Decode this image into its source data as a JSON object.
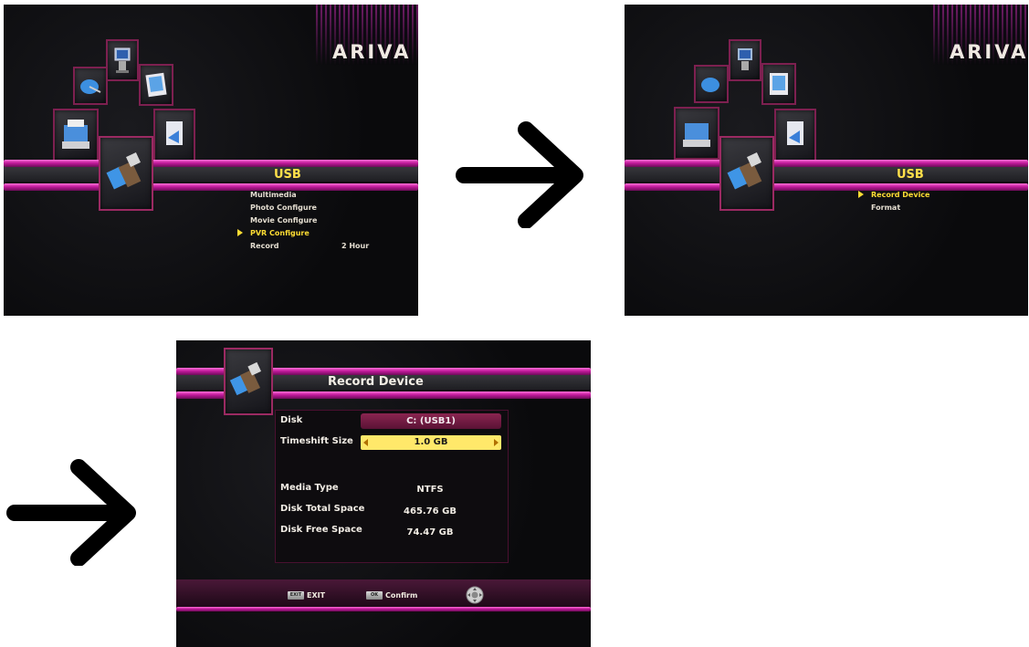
{
  "brand": {
    "logo_text": "ARIVA"
  },
  "screen1": {
    "title": "USB",
    "menu": [
      {
        "label": "Multimedia",
        "value": "",
        "selected": false
      },
      {
        "label": "Photo Configure",
        "value": "",
        "selected": false
      },
      {
        "label": "Movie Configure",
        "value": "",
        "selected": false
      },
      {
        "label": "PVR Configure",
        "value": "",
        "selected": true
      },
      {
        "label": "Record",
        "value": "2 Hour",
        "selected": false
      }
    ]
  },
  "screen2": {
    "title": "USB",
    "menu": [
      {
        "label": "Record Device",
        "selected": true
      },
      {
        "label": "Format",
        "selected": false
      }
    ]
  },
  "screen3": {
    "title": "Record Device",
    "disk_label": "Disk",
    "disk_value": "C: (USB1)",
    "timeshift_label": "Timeshift Size",
    "timeshift_value": "1.0 GB",
    "media_type_label": "Media Type",
    "media_type_value": "NTFS",
    "total_label": "Disk Total Space",
    "total_value": "465.76 GB",
    "free_label": "Disk Free Space",
    "free_value": "74.47 GB",
    "footer": {
      "exit_key": "EXIT",
      "exit_label": "EXIT",
      "ok_key": "OK",
      "ok_label": "Confirm"
    }
  },
  "colors": {
    "accent_pink": "#c21a9c",
    "highlight_yellow": "#ffdd33",
    "background": "#0b0b0d"
  }
}
